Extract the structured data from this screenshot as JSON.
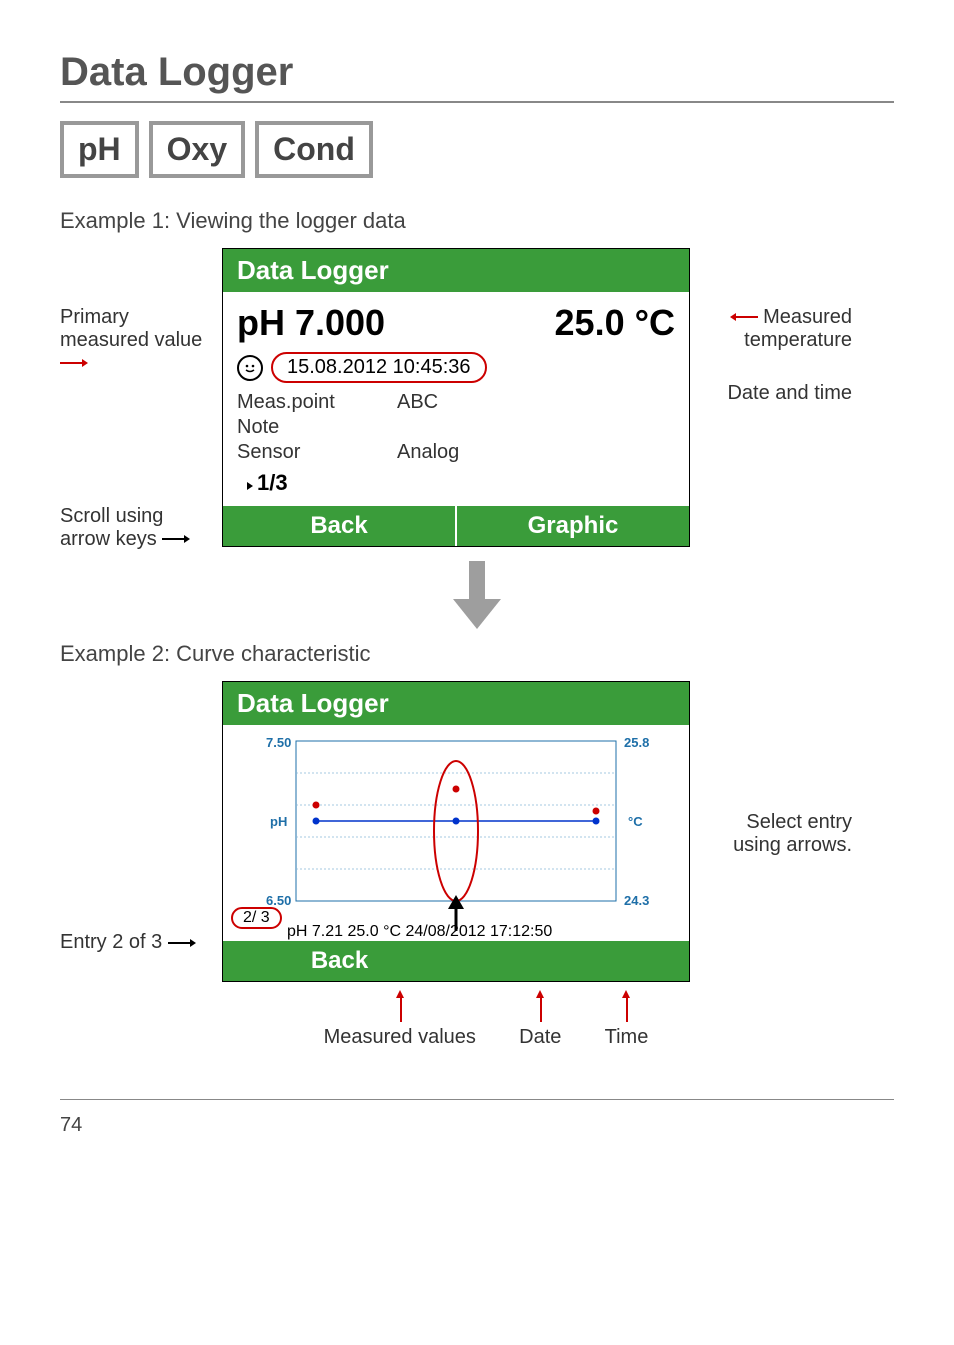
{
  "page": {
    "title": "Data Logger",
    "number": "74"
  },
  "tabs": [
    "pH",
    "Oxy",
    "Cond"
  ],
  "example1": {
    "label": "Example 1: Viewing the logger data",
    "leftAnn1": "Primary measured value",
    "leftAnn2": "Scroll using arrow keys",
    "rightAnn1": "Measured temperature",
    "rightAnn2": "Date and time",
    "screen": {
      "header": "Data Logger",
      "primary": "pH 7.000",
      "temp": "25.0 °C",
      "datetime": "15.08.2012  10:45:36",
      "rows": [
        {
          "k": "Meas.point",
          "v": "ABC"
        },
        {
          "k": "Note",
          "v": ""
        },
        {
          "k": "Sensor",
          "v": "Analog"
        }
      ],
      "counter": "1/3",
      "btnBack": "Back",
      "btnGraphic": "Graphic"
    }
  },
  "example2": {
    "label": "Example 2: Curve characteristic",
    "leftAnn": "Entry 2 of 3",
    "rightAnn": "Select entry using arrows.",
    "screen": {
      "header": "Data Logger",
      "entryCounter": "2/ 3",
      "entryLine": "pH 7.21 25.0 °C  24/08/2012  17:12:50",
      "btnBack": "Back"
    },
    "callouts": {
      "values": "Measured values",
      "date": "Date",
      "time": "Time"
    }
  },
  "chart_data": {
    "type": "line",
    "title": "",
    "xlabel": "",
    "series": [
      {
        "name": "pH",
        "color": "#cc0000",
        "ylabel": "pH",
        "ylim": [
          6.5,
          7.5
        ],
        "values": [
          7.1,
          7.21,
          7.06
        ]
      },
      {
        "name": "°C",
        "color": "#0033cc",
        "ylabel": "°C",
        "ylim": [
          24.3,
          25.8
        ],
        "values": [
          25.0,
          25.0,
          25.0
        ]
      }
    ],
    "x": [
      1,
      2,
      3
    ],
    "selected_index": 1
  }
}
